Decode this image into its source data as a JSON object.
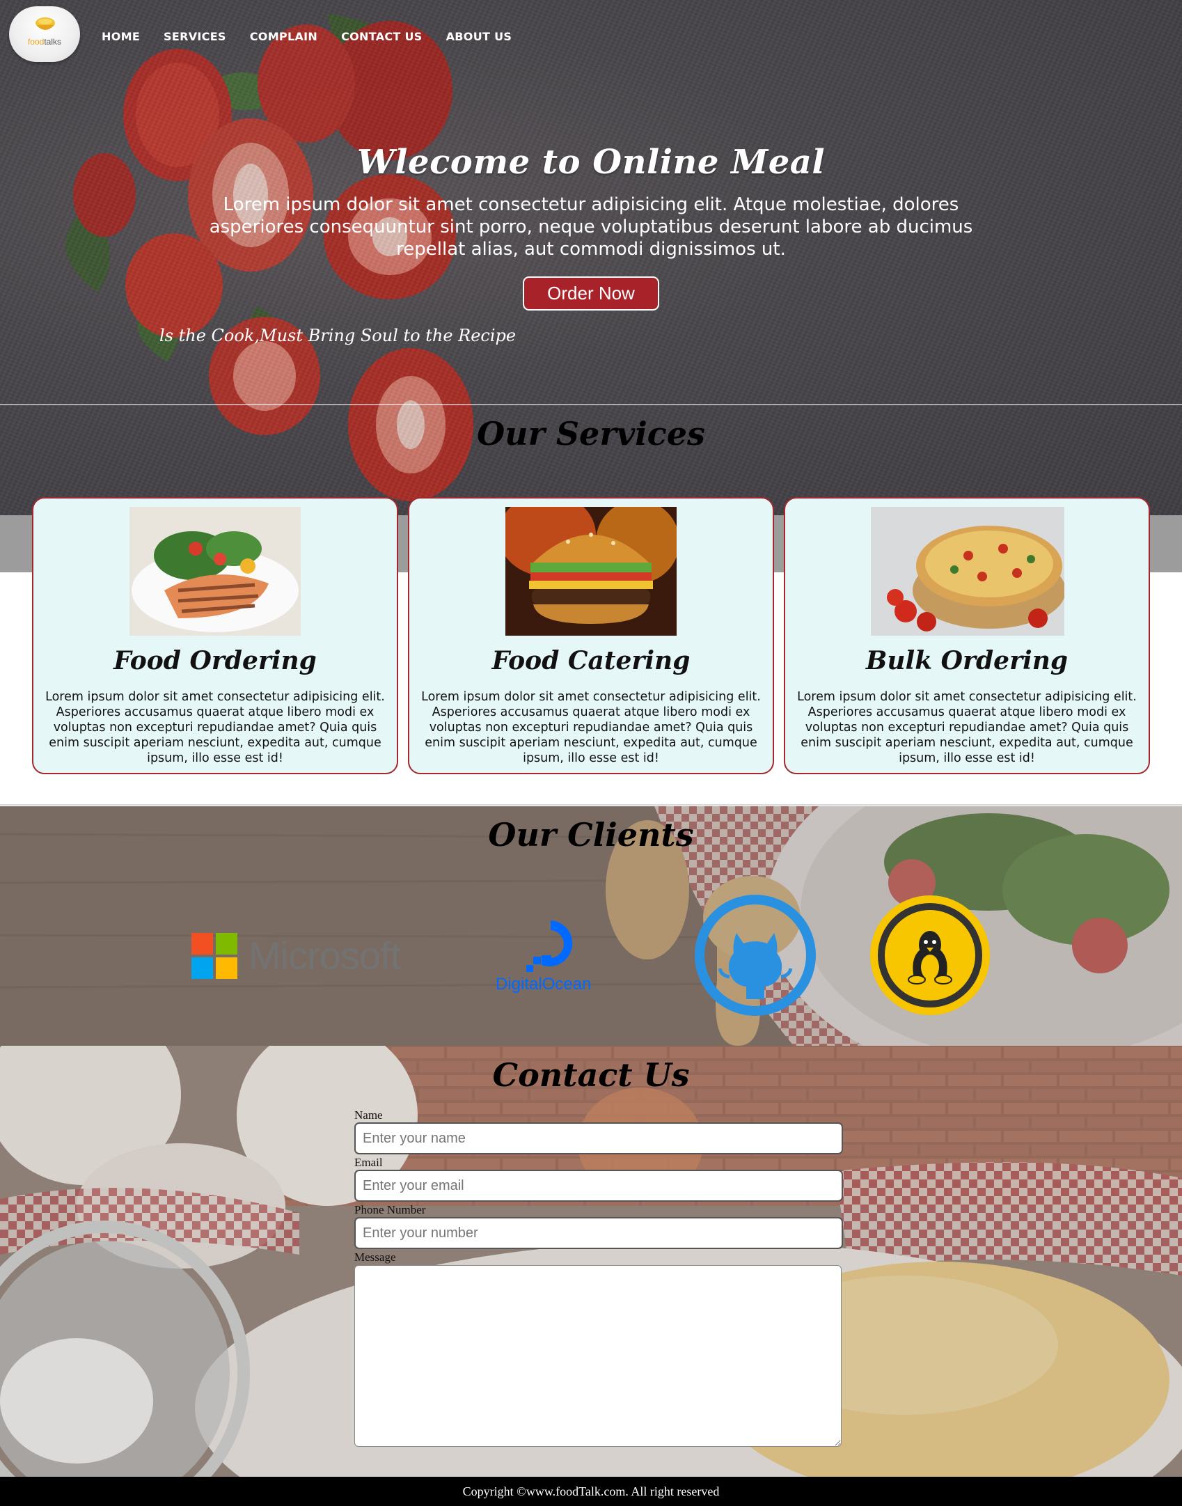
{
  "nav": {
    "logo_text_a": "food",
    "logo_text_b": "talks",
    "items": [
      "HOME",
      "SERVICES",
      "COMPLAIN",
      "CONTACT US",
      "ABOUT US"
    ]
  },
  "hero": {
    "title": "Wlecome to Online Meal",
    "text": "Lorem ipsum dolor sit amet consectetur adipisicing elit. Atque molestiae, dolores asperiores consequuntur sint porro, neque voluptatibus deserunt labore ab ducimus repellat alias, aut commodi dignissimos ut.",
    "button": "Order Now",
    "tagline": "ls the Cook,Must Bring Soul to the Recipe"
  },
  "services": {
    "title": "Our Services",
    "cards": [
      {
        "title": "Food Ordering",
        "text": "Lorem ipsum dolor sit amet consectetur adipisicing elit. Asperiores accusamus quaerat atque libero modi ex voluptas non excepturi repudiandae amet? Quia quis enim suscipit aperiam nesciunt, expedita aut, cumque ipsum, illo esse est id!"
      },
      {
        "title": "Food Catering",
        "text": "Lorem ipsum dolor sit amet consectetur adipisicing elit. Asperiores accusamus quaerat atque libero modi ex voluptas non excepturi repudiandae amet? Quia quis enim suscipit aperiam nesciunt, expedita aut, cumque ipsum, illo esse est id!"
      },
      {
        "title": "Bulk Ordering",
        "text": "Lorem ipsum dolor sit amet consectetur adipisicing elit. Asperiores accusamus quaerat atque libero modi ex voluptas non excepturi repudiandae amet? Quia quis enim suscipit aperiam nesciunt, expedita aut, cumque ipsum, illo esse est id!"
      }
    ]
  },
  "clients": {
    "title": "Our Clients",
    "logos": {
      "microsoft": "Microsoft",
      "digitalocean": "DigitalOcean",
      "github_icon": "github-icon",
      "linux_icon": "linux-tux-icon"
    }
  },
  "contact": {
    "title": "Contact Us",
    "fields": {
      "name_label": "Name",
      "name_placeholder": "Enter your name",
      "email_label": "Email",
      "email_placeholder": "Enter your email",
      "phone_label": "Phone Number",
      "phone_placeholder": "Enter your number",
      "message_label": "Message"
    }
  },
  "footer": {
    "text": "Copyright ©www.foodTalk.com. All right reserved"
  },
  "colors": {
    "accent": "#a8222a",
    "card_bg": "#e6f7f8",
    "card_border": "#a3282d"
  }
}
